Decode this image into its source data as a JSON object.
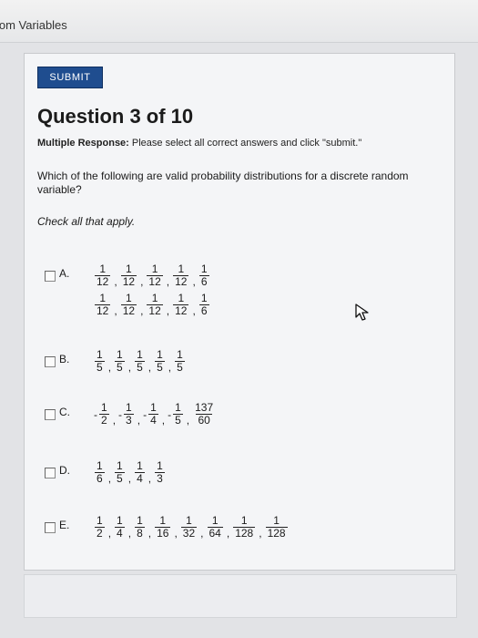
{
  "header": {
    "breadcrumb": "lom Variables"
  },
  "toolbar": {
    "submit_label": "SUBMIT"
  },
  "question": {
    "title": "Question 3 of 10",
    "type_label": "Multiple Response:",
    "type_instructions": "Please select all correct answers and click \"submit.\"",
    "text": "Which of the following are valid probability distributions for a discrete random variable?",
    "hint": "Check all that apply."
  },
  "options": [
    {
      "letter": "A.",
      "rows": [
        [
          {
            "n": "1",
            "d": "12"
          },
          {
            "n": "1",
            "d": "12"
          },
          {
            "n": "1",
            "d": "12"
          },
          {
            "n": "1",
            "d": "12"
          },
          {
            "n": "1",
            "d": "6"
          }
        ],
        [
          {
            "n": "1",
            "d": "12"
          },
          {
            "n": "1",
            "d": "12"
          },
          {
            "n": "1",
            "d": "12"
          },
          {
            "n": "1",
            "d": "12"
          },
          {
            "n": "1",
            "d": "6"
          }
        ]
      ]
    },
    {
      "letter": "B.",
      "rows": [
        [
          {
            "n": "1",
            "d": "5"
          },
          {
            "n": "1",
            "d": "5"
          },
          {
            "n": "1",
            "d": "5"
          },
          {
            "n": "1",
            "d": "5"
          },
          {
            "n": "1",
            "d": "5"
          }
        ]
      ]
    },
    {
      "letter": "C.",
      "rows": [
        [
          {
            "n": "1",
            "d": "2",
            "neg": true
          },
          {
            "n": "1",
            "d": "3",
            "neg": true
          },
          {
            "n": "1",
            "d": "4",
            "neg": true
          },
          {
            "n": "1",
            "d": "5",
            "neg": true
          },
          {
            "n": "137",
            "d": "60"
          }
        ]
      ]
    },
    {
      "letter": "D.",
      "rows": [
        [
          {
            "n": "1",
            "d": "6"
          },
          {
            "n": "1",
            "d": "5"
          },
          {
            "n": "1",
            "d": "4"
          },
          {
            "n": "1",
            "d": "3"
          }
        ]
      ]
    },
    {
      "letter": "E.",
      "rows": [
        [
          {
            "n": "1",
            "d": "2"
          },
          {
            "n": "1",
            "d": "4"
          },
          {
            "n": "1",
            "d": "8"
          },
          {
            "n": "1",
            "d": "16"
          },
          {
            "n": "1",
            "d": "32"
          },
          {
            "n": "1",
            "d": "64"
          },
          {
            "n": "1",
            "d": "128"
          },
          {
            "n": "1",
            "d": "128"
          }
        ]
      ]
    }
  ],
  "icons": {
    "pointer": "mouse-pointer-icon"
  }
}
